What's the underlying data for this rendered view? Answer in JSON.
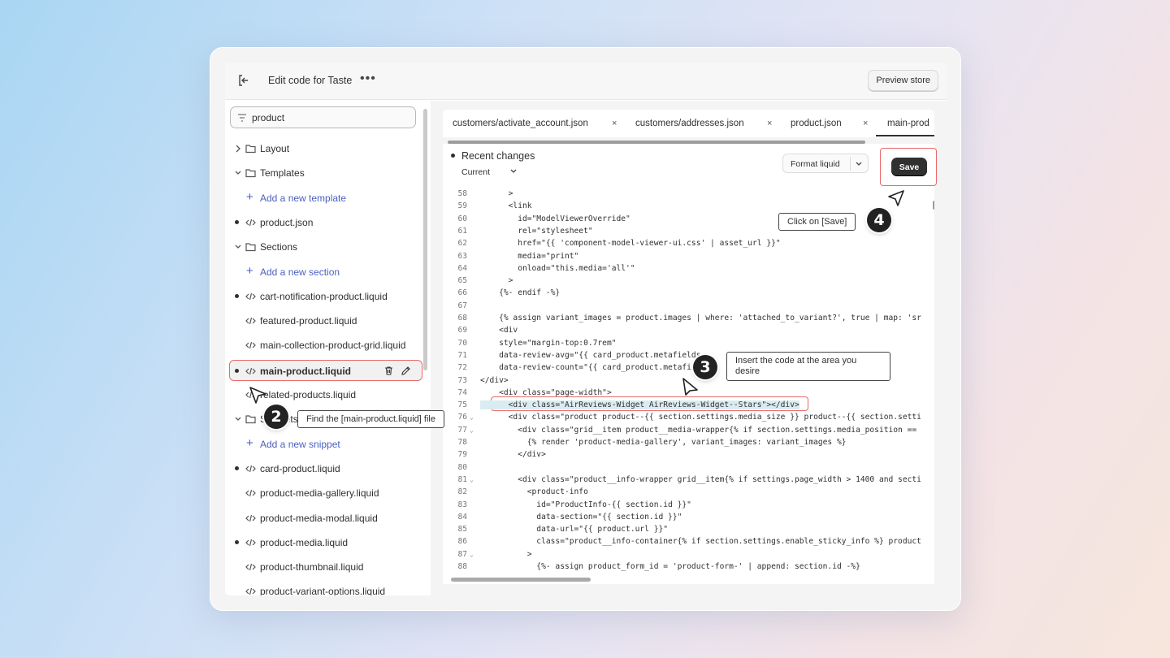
{
  "topbar": {
    "title": "Edit code for Taste",
    "preview_label": "Preview store"
  },
  "sidebar": {
    "search_value": "product",
    "items": [
      {
        "type": "folder",
        "label": "Layout"
      },
      {
        "type": "folder-open",
        "label": "Templates"
      },
      {
        "type": "add",
        "label": "Add a new template"
      },
      {
        "type": "file",
        "label": "product.json",
        "dot": true
      },
      {
        "type": "folder-open",
        "label": "Sections"
      },
      {
        "type": "add",
        "label": "Add a new section"
      },
      {
        "type": "file",
        "label": "cart-notification-product.liquid",
        "dot": true
      },
      {
        "type": "file",
        "label": "featured-product.liquid"
      },
      {
        "type": "file",
        "label": "main-collection-product-grid.liquid"
      },
      {
        "type": "file",
        "label": "main-product.liquid",
        "dot": true,
        "active": true
      },
      {
        "type": "file",
        "label": "related-products.liquid"
      },
      {
        "type": "folder-open",
        "label": "Snippets"
      },
      {
        "type": "add",
        "label": "Add a new snippet"
      },
      {
        "type": "file",
        "label": "card-product.liquid",
        "dot": true
      },
      {
        "type": "file",
        "label": "product-media-gallery.liquid"
      },
      {
        "type": "file",
        "label": "product-media-modal.liquid"
      },
      {
        "type": "file",
        "label": "product-media.liquid",
        "dot": true
      },
      {
        "type": "file",
        "label": "product-thumbnail.liquid"
      },
      {
        "type": "file",
        "label": "product-variant-options.liquid"
      }
    ]
  },
  "tabs": [
    "customers/activate_account.json",
    "customers/addresses.json",
    "product.json",
    "main-prod"
  ],
  "editor": {
    "recent_changes": "Recent changes",
    "current": "Current",
    "format_label": "Format liquid",
    "save_label": "Save"
  },
  "code_lines": [
    {
      "n": "58",
      "t": "      >"
    },
    {
      "n": "59",
      "t": "      <link"
    },
    {
      "n": "60",
      "t": "        id=\"ModelViewerOverride\""
    },
    {
      "n": "61",
      "t": "        rel=\"stylesheet\""
    },
    {
      "n": "62",
      "t": "        href=\"{{ 'component-model-viewer-ui.css' | asset_url }}\""
    },
    {
      "n": "63",
      "t": "        media=\"print\""
    },
    {
      "n": "64",
      "t": "        onload=\"this.media='all'\""
    },
    {
      "n": "65",
      "t": "      >"
    },
    {
      "n": "66",
      "t": "    {%- endif -%}"
    },
    {
      "n": "67",
      "t": ""
    },
    {
      "n": "68",
      "t": "    {% assign variant_images = product.images | where: 'attached_to_variant?', true | map: 'sr"
    },
    {
      "n": "69",
      "t": "    <div"
    },
    {
      "n": "70",
      "t": "    style=\"margin-top:0.7rem\""
    },
    {
      "n": "71",
      "t": "    data-review-avg=\"{{ card_product.metafields"
    },
    {
      "n": "72",
      "t": "    data-review-count=\"{{ card_product.metafie"
    },
    {
      "n": "73",
      "t": "</div>"
    },
    {
      "n": "74",
      "t": "    <div class=\"page-width\">"
    },
    {
      "n": "75",
      "t": "      <div class=\"AirReviews-Widget AirReviews-Widget--Stars\"></div>"
    },
    {
      "n": "76",
      "t": "      <div class=\"product product--{{ section.settings.media_size }} product--{{ section.setti"
    },
    {
      "n": "77",
      "t": "        <div class=\"grid__item product__media-wrapper{% if section.settings.media_position =="
    },
    {
      "n": "78",
      "t": "          {% render 'product-media-gallery', variant_images: variant_images %}"
    },
    {
      "n": "79",
      "t": "        </div>"
    },
    {
      "n": "80",
      "t": ""
    },
    {
      "n": "81",
      "t": "        <div class=\"product__info-wrapper grid__item{% if settings.page_width > 1400 and secti"
    },
    {
      "n": "82",
      "t": "          <product-info"
    },
    {
      "n": "83",
      "t": "            id=\"ProductInfo-{{ section.id }}\""
    },
    {
      "n": "84",
      "t": "            data-section=\"{{ section.id }}\""
    },
    {
      "n": "85",
      "t": "            data-url=\"{{ product.url }}\""
    },
    {
      "n": "86",
      "t": "            class=\"product__info-container{% if section.settings.enable_sticky_info %} product"
    },
    {
      "n": "87",
      "t": "          >"
    },
    {
      "n": "88",
      "t": "            {%- assign product_form_id = 'product-form-' | append: section.id -%}"
    }
  ],
  "callouts": {
    "step2": {
      "num": "2",
      "text": "Find the [main-product.liquid] file"
    },
    "step3": {
      "num": "3",
      "text": "Insert the code at the area you desire"
    },
    "step4": {
      "num": "4",
      "text": "Click on [Save]"
    }
  }
}
